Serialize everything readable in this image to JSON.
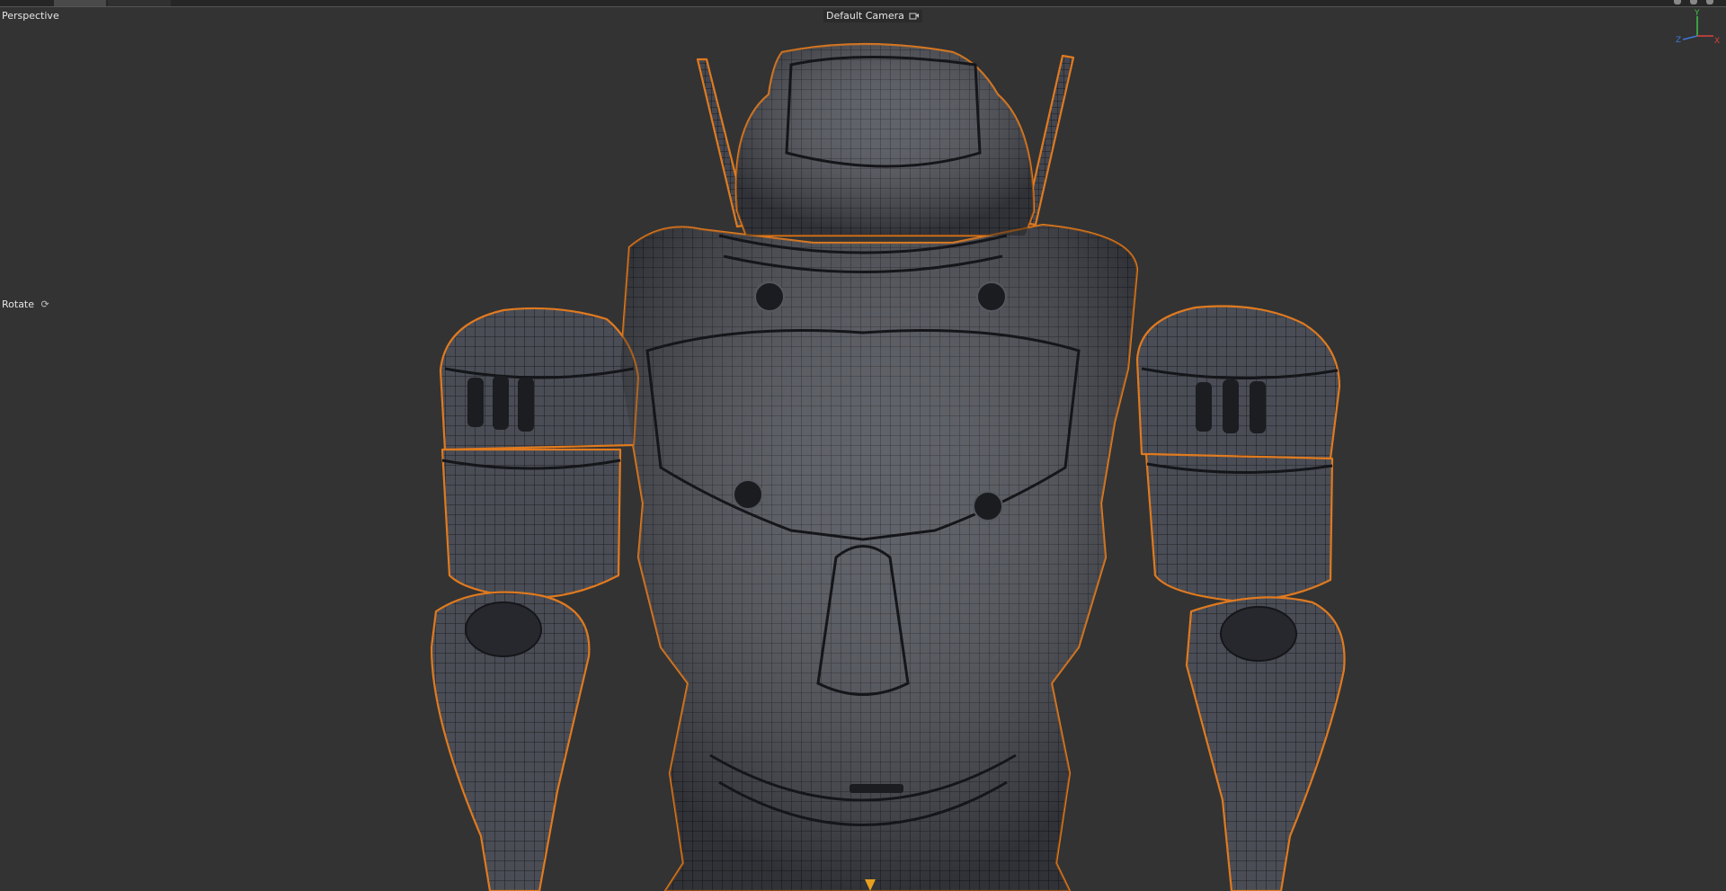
{
  "viewport": {
    "view_label": "Perspective",
    "camera_label": "Default Camera",
    "camera_icon": "camera-toggle-icon",
    "tool_label": "Rotate",
    "tool_icon": "rotate-icon",
    "axis_labels": {
      "y": "Y",
      "z": "Z",
      "x": "X"
    },
    "colors": {
      "background": "#333333",
      "selection_outline": "#e07a1f",
      "mesh_fill": "#4a4d55",
      "wire": "#1e1f24",
      "axis_y": "#3cc24a",
      "axis_z": "#3a7bd5",
      "axis_x": "#d9423a",
      "pivot": "#e6a01e"
    }
  }
}
